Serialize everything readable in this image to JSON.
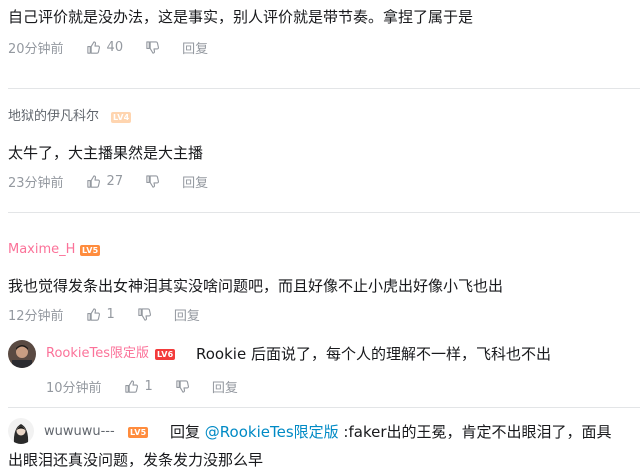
{
  "comments": [
    {
      "text": "自己评价就是没办法，这是事实，别人评价就是带节奏。拿捏了属于是",
      "time": "20分钟前",
      "likes": "40",
      "reply_label": "回复"
    },
    {
      "username": "地狱的伊凡科尔",
      "level": "LV4",
      "text": "太牛了，大主播果然是大主播",
      "time": "23分钟前",
      "likes": "27",
      "reply_label": "回复"
    },
    {
      "username": "Maxime_H",
      "level": "LV5",
      "text": "我也觉得发条出女神泪其实没啥问题吧，而且好像不止小虎出好像小飞也出",
      "time": "12分钟前",
      "likes": "1",
      "reply_label": "回复",
      "replies": [
        {
          "username": "RookieTes限定版",
          "level": "LV6",
          "text": "Rookie 后面说了，每个人的理解不一样，飞科也不出",
          "time": "10分钟前",
          "likes": "1",
          "reply_label": "回复"
        }
      ]
    },
    {
      "username": "wuwuwu---",
      "level": "LV5",
      "reply_prefix": "回复",
      "mention": "@RookieTes限定版",
      "text_line1": ":faker出的王冕，肯定不出眼泪了，面具",
      "text_line2": "出眼泪还真没问题，发条发力没那么早"
    }
  ],
  "colors": {
    "pink_username": "#fb7299",
    "link": "#008ac5",
    "meta_grey": "#9499a0"
  },
  "icons": [
    "thumb-up-icon",
    "thumb-down-icon"
  ]
}
